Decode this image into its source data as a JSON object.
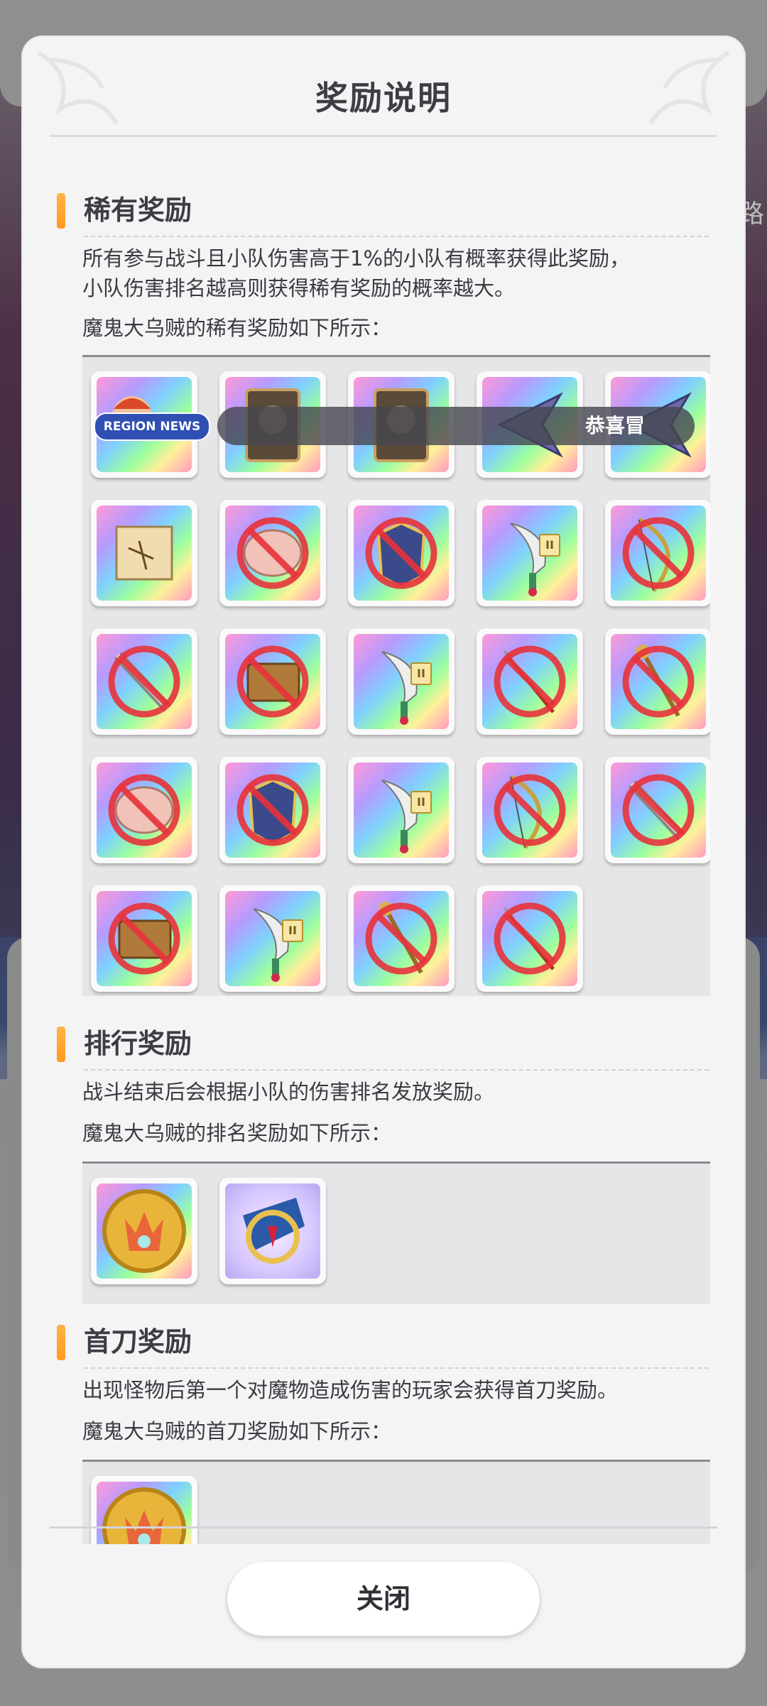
{
  "background": {
    "side_text": "路"
  },
  "dialog": {
    "title": "奖励说明",
    "close_label": "关闭"
  },
  "rare": {
    "heading": "稀有奖励",
    "desc_line1": "所有参与战斗且小队伤害高于1%的小队有概率获得此奖励，",
    "desc_line2": "小队伤害排名越高则获得稀有奖励的概率越大。",
    "list_label": "魔鬼大乌贼的稀有奖励如下所示：",
    "news_badge": "REGION NEWS",
    "news_text": "恭喜冒",
    "items": [
      {
        "icon": "news-character-icon",
        "banned": false
      },
      {
        "icon": "card-pack-icon",
        "banned": false
      },
      {
        "icon": "card-pack-icon",
        "banned": false
      },
      {
        "icon": "arrow-shard-icon",
        "banned": false
      },
      {
        "icon": "arrow-shard-icon",
        "banned": false
      },
      {
        "icon": "treasure-map-icon",
        "banned": false
      },
      {
        "icon": "brain-material-icon",
        "banned": true
      },
      {
        "icon": "armor-icon",
        "banned": true
      },
      {
        "icon": "dagger-icon",
        "banned": false,
        "rank": "II"
      },
      {
        "icon": "bow-icon",
        "banned": true
      },
      {
        "icon": "saw-sword-icon",
        "banned": true
      },
      {
        "icon": "book-icon",
        "banned": true
      },
      {
        "icon": "dagger-icon",
        "banned": false,
        "rank": "II"
      },
      {
        "icon": "spear-icon",
        "banned": true
      },
      {
        "icon": "staff-icon",
        "banned": true
      },
      {
        "icon": "brain-material-icon",
        "banned": true
      },
      {
        "icon": "armor-icon",
        "banned": true
      },
      {
        "icon": "dagger-icon",
        "banned": false,
        "rank": "II"
      },
      {
        "icon": "bow-icon",
        "banned": true
      },
      {
        "icon": "saw-sword-icon",
        "banned": true
      },
      {
        "icon": "book-icon",
        "banned": true
      },
      {
        "icon": "dagger-icon",
        "banned": false,
        "rank": "II"
      },
      {
        "icon": "staff-icon",
        "banned": true
      },
      {
        "icon": "spear-icon",
        "banned": true
      }
    ]
  },
  "ranking": {
    "heading": "排行奖励",
    "desc": "战斗结束后会根据小队的伤害排名发放奖励。",
    "list_label": "魔鬼大乌贼的排名奖励如下所示：",
    "items": [
      {
        "icon": "crown-coin-icon"
      },
      {
        "icon": "emblem-icon"
      }
    ]
  },
  "first_strike": {
    "heading": "首刀奖励",
    "desc": "出现怪物后第一个对魔物造成伤害的玩家会获得首刀奖励。",
    "list_label": "魔鬼大乌贼的首刀奖励如下所示：",
    "items": [
      {
        "icon": "crown-coin-icon"
      }
    ]
  },
  "colors": {
    "accent": "#ff9a1f",
    "title_text": "#3d3d45",
    "ban_red": "#e8323a"
  }
}
